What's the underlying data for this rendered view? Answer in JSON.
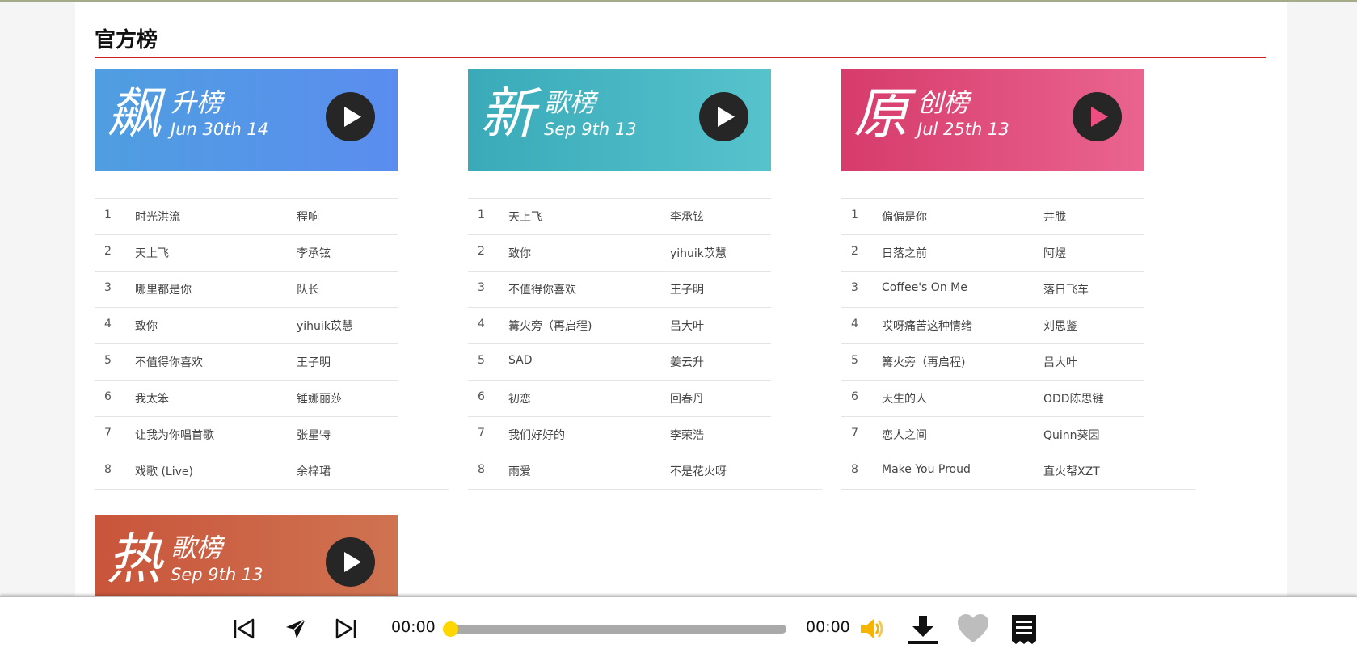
{
  "section_title": "官方榜",
  "charts": [
    {
      "big": "飙",
      "small": "升榜",
      "date": "Jun 30th 14",
      "songs": [
        {
          "rank": "1",
          "name": "时光洪流",
          "artist": "程响"
        },
        {
          "rank": "2",
          "name": "天上飞",
          "artist": "李承铉"
        },
        {
          "rank": "3",
          "name": "哪里都是你",
          "artist": "队长"
        },
        {
          "rank": "4",
          "name": "致你",
          "artist": "yihuik苡慧"
        },
        {
          "rank": "5",
          "name": "不值得你喜欢",
          "artist": "王子明"
        },
        {
          "rank": "6",
          "name": "我太笨",
          "artist": "锤娜丽莎"
        },
        {
          "rank": "7",
          "name": "让我为你唱首歌",
          "artist": "张星特"
        },
        {
          "rank": "8",
          "name": "戏歌 (Live)",
          "artist": "余梓珺"
        }
      ]
    },
    {
      "big": "新",
      "small": "歌榜",
      "date": "Sep 9th 13",
      "songs": [
        {
          "rank": "1",
          "name": "天上飞",
          "artist": "李承铉"
        },
        {
          "rank": "2",
          "name": "致你",
          "artist": "yihuik苡慧"
        },
        {
          "rank": "3",
          "name": "不值得你喜欢",
          "artist": "王子明"
        },
        {
          "rank": "4",
          "name": "篝火旁（再启程)",
          "artist": "吕大叶"
        },
        {
          "rank": "5",
          "name": "SAD",
          "artist": "姜云升"
        },
        {
          "rank": "6",
          "name": "初恋",
          "artist": "回春丹"
        },
        {
          "rank": "7",
          "name": "我们好好的",
          "artist": "李荣浩"
        },
        {
          "rank": "8",
          "name": "雨爱",
          "artist": "不是花火呀"
        }
      ]
    },
    {
      "big": "原",
      "small": "创榜",
      "date": "Jul 25th 13",
      "songs": [
        {
          "rank": "1",
          "name": "偏偏是你",
          "artist": "井胧"
        },
        {
          "rank": "2",
          "name": "日落之前",
          "artist": "阿煜"
        },
        {
          "rank": "3",
          "name": "Coffee's On Me",
          "artist": "落日飞车"
        },
        {
          "rank": "4",
          "name": "哎呀痛苦这种情绪",
          "artist": "刘思鉴"
        },
        {
          "rank": "5",
          "name": "篝火旁（再启程)",
          "artist": "吕大叶"
        },
        {
          "rank": "6",
          "name": "天生的人",
          "artist": "ODD陈思键"
        },
        {
          "rank": "7",
          "name": "恋人之间",
          "artist": "Quinn葵因"
        },
        {
          "rank": "8",
          "name": "Make You Proud",
          "artist": "直火帮XZT"
        }
      ]
    },
    {
      "big": "热",
      "small": "歌榜",
      "date": "Sep 9th 13",
      "songs": []
    }
  ],
  "colors": {
    "accent_rule": "#cc1f1f",
    "banner_soaring": [
      "#4f9ee0",
      "#5b8def"
    ],
    "banner_new": [
      "#3aaab9",
      "#56c3cc"
    ],
    "banner_original": [
      "#d63b6b",
      "#ea6490"
    ],
    "banner_hot": [
      "#c9553b",
      "#cf7351"
    ],
    "progress_knob": "#ffd600",
    "volume": "#f5b400"
  },
  "player": {
    "current_time": "00:00",
    "total_time": "00:00",
    "progress": 0,
    "icons": [
      "previous-icon",
      "share-icon",
      "next-icon",
      "volume-icon",
      "download-icon",
      "heart-icon",
      "playlist-icon"
    ]
  }
}
